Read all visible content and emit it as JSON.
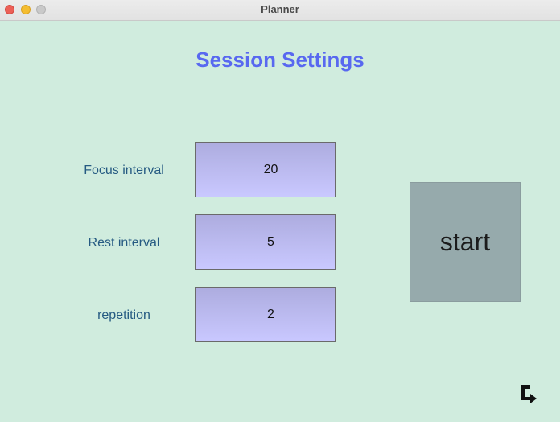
{
  "window": {
    "title": "Planner"
  },
  "page": {
    "heading": "Session Settings"
  },
  "settings": [
    {
      "label": "Focus interval",
      "value": "20"
    },
    {
      "label": "Rest interval",
      "value": "5"
    },
    {
      "label": "repetition",
      "value": "2"
    }
  ],
  "actions": {
    "start_label": "start"
  },
  "icons": {
    "corner": "swap-arrow-icon"
  },
  "colors": {
    "background": "#d0ecde",
    "heading": "#5868f0",
    "label": "#255a82",
    "value_box": "#c9c8ff",
    "start_button": "#96aaac"
  }
}
